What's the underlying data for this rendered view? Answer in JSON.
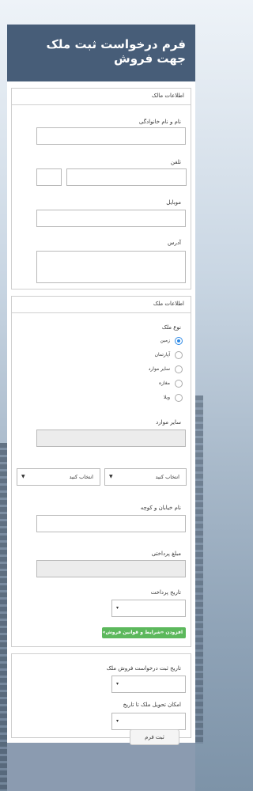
{
  "header": {
    "title": "فرم درخواست ثبت ملک جهت فروش"
  },
  "owner_section": {
    "title": "اطلاعات مالک",
    "name_label": "نام و نام خانوادگی",
    "phone_label": "تلفن",
    "mobile_label": "موبایل",
    "address_label": "آدرس"
  },
  "property_section": {
    "title": "اطلاعات ملک",
    "type_label": "نوع ملک",
    "type_options": [
      "زمین",
      "آپارتمان",
      "سایر موارد",
      "مغازه",
      "ویلا"
    ],
    "selected_type": "زمین",
    "other_label": "سایر موارد",
    "select_left": "انتخاب کنید",
    "select_right": "انتخاب کنید",
    "street_label": "نام خیابان و کوچه",
    "payment_label": "مبلغ پرداختی",
    "payment_date_label": "تاریخ پرداخت",
    "add_button": "افزودن «شرایط و قوانین فروش» جدید"
  },
  "dates_section": {
    "request_date_label": "تاریخ ثبت درخواست فروش ملک",
    "delivery_label": "امکان تحویل ملک تا تاریخ"
  },
  "submit": {
    "label": "ثبت فرم"
  },
  "colors": {
    "header": "#475d78",
    "footer": "#8b9bb0",
    "accent": "#2e8ae6",
    "add_button": "#5cb85c"
  }
}
